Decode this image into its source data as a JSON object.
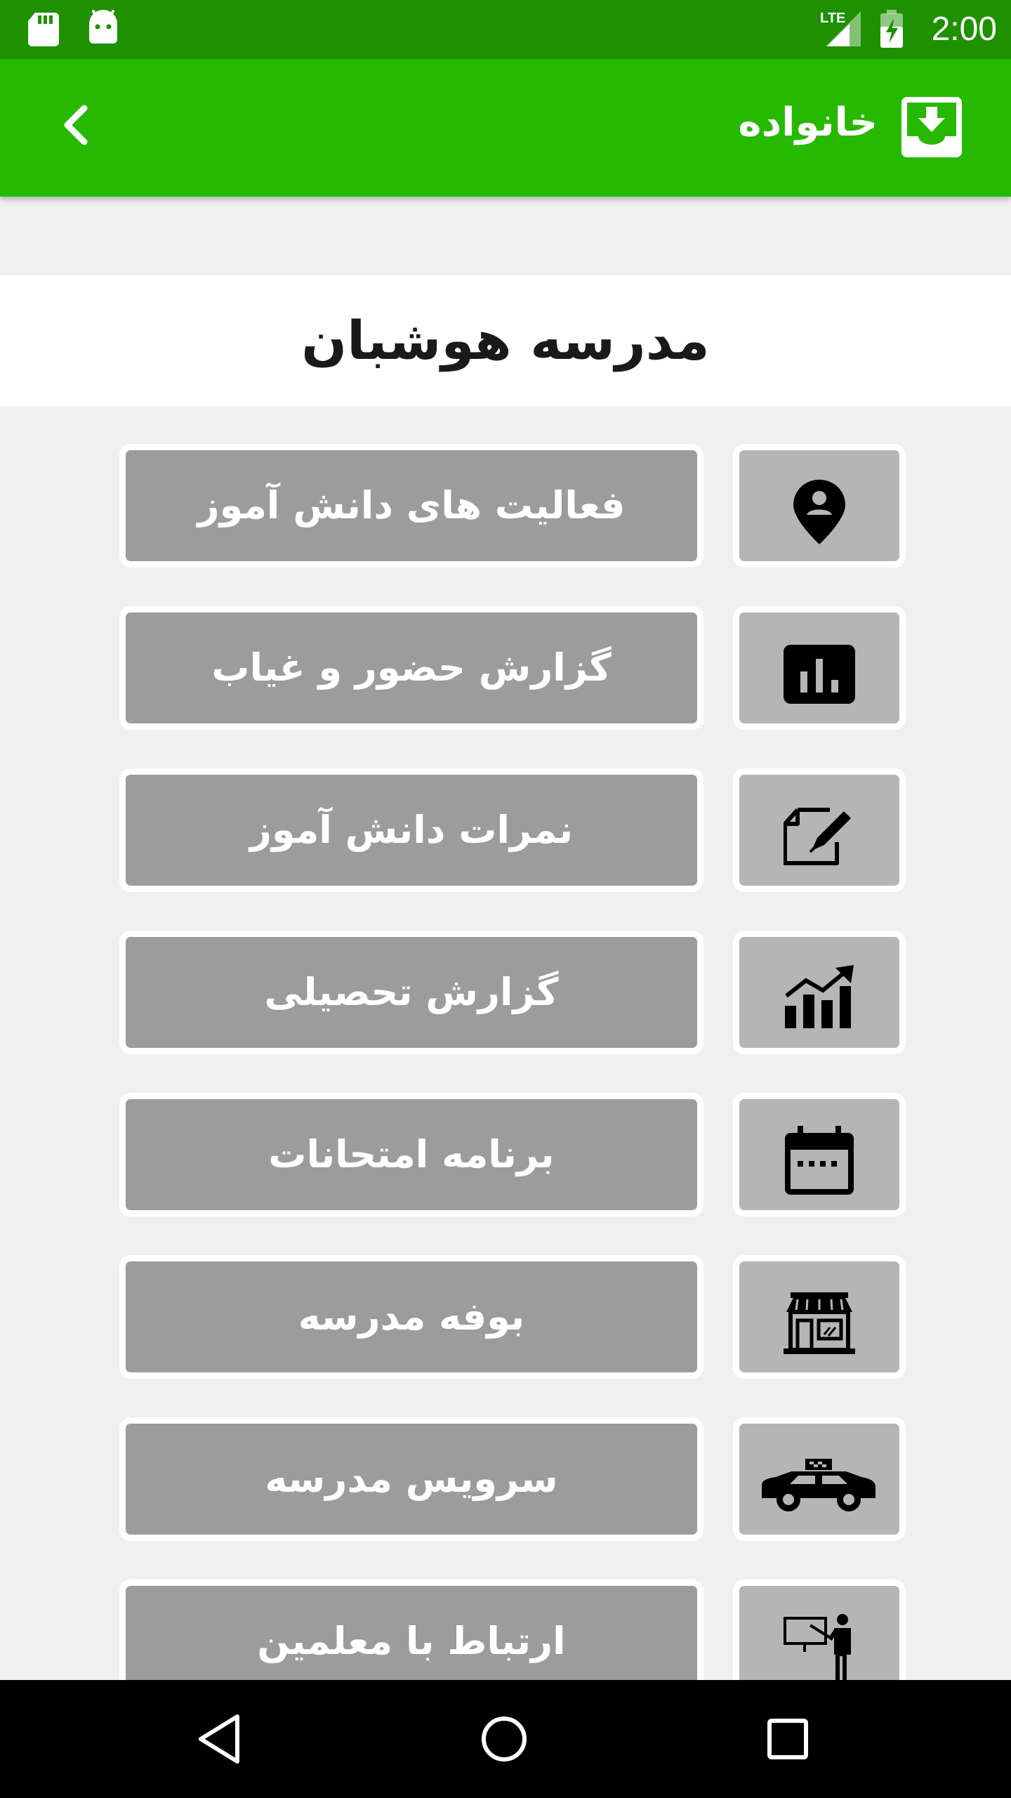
{
  "status_bar": {
    "time": "2:00",
    "network": "LTE",
    "icons": [
      "sd-card-icon",
      "android-icon",
      "signal-icon",
      "battery-charging-icon"
    ]
  },
  "app_bar": {
    "title": "خانواده",
    "back_icon": "chevron-left-icon",
    "title_icon": "inbox-download-icon",
    "color": "#27b900"
  },
  "school": {
    "name": "مدرسه هوشبان"
  },
  "menu": {
    "items": [
      {
        "label": "فعالیت های دانش آموز",
        "icon": "location-person-icon"
      },
      {
        "label": "گزارش حضور و غیاب",
        "icon": "bar-chart-icon"
      },
      {
        "label": "نمرات دانش آموز",
        "icon": "edit-note-icon"
      },
      {
        "label": "گزارش تحصیلی",
        "icon": "growth-chart-icon"
      },
      {
        "label": "برنامه امتحانات",
        "icon": "calendar-icon"
      },
      {
        "label": "بوفه مدرسه",
        "icon": "store-icon"
      },
      {
        "label": "سرویس مدرسه",
        "icon": "taxi-icon"
      },
      {
        "label": "ارتباط با معلمین",
        "icon": "teacher-icon"
      }
    ]
  },
  "colors": {
    "status_bar": "#1f9100",
    "app_bar": "#27b900",
    "label_button": "#9c9c9c",
    "icon_tile": "#b5b5b5",
    "background": "#f0f0f0"
  },
  "nav_bar": {
    "icons": [
      "nav-back-icon",
      "nav-home-icon",
      "nav-recents-icon"
    ]
  }
}
